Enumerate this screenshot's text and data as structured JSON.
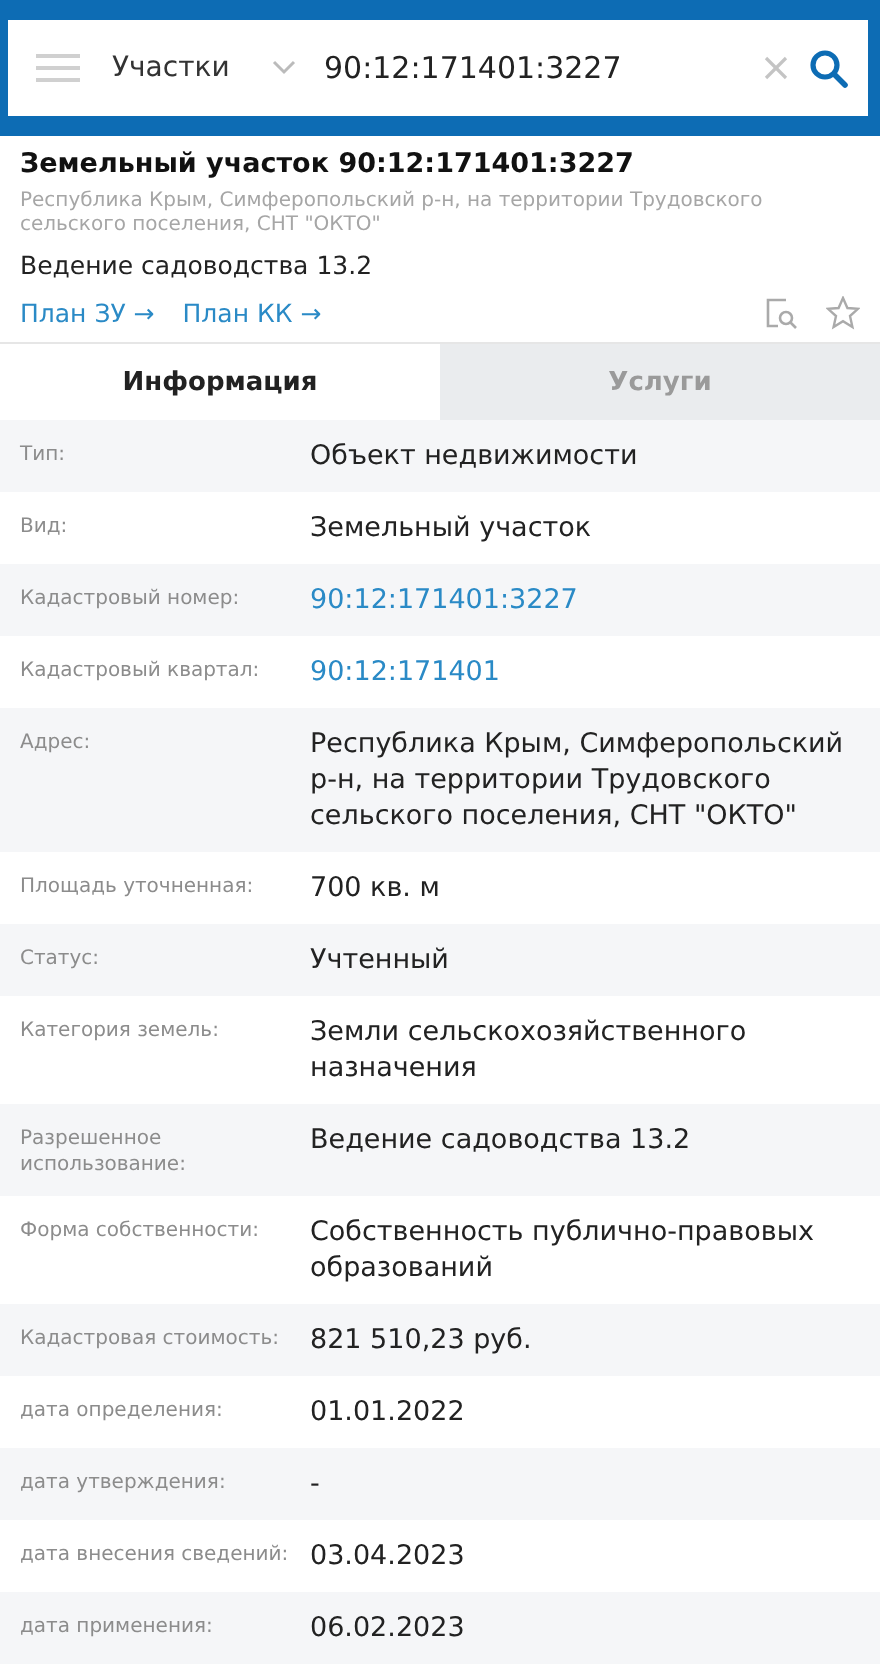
{
  "search": {
    "category": "Участки",
    "value": "90:12:171401:3227"
  },
  "object": {
    "title": "Земельный участок 90:12:171401:3227",
    "address": "Республика Крым, Симферопольский р-н, на территории Трудовского сельского поселения, СНТ \"ОКТО\"",
    "usage": "Ведение садоводства 13.2",
    "links": [
      "План ЗУ →",
      "План КК →"
    ],
    "favorite": false
  },
  "tabs": [
    {
      "label": "Информация",
      "selected": true
    },
    {
      "label": "Услуги",
      "selected": false
    }
  ],
  "rows": [
    {
      "label": "Тип:",
      "value": "Объект недвижимости",
      "kind": "text"
    },
    {
      "label": "Вид:",
      "value": "Земельный участок",
      "kind": "text"
    },
    {
      "label": "Кадастровый номер:",
      "value": "90:12:171401:3227",
      "kind": "link"
    },
    {
      "label": "Кадастровый квартал:",
      "value": "90:12:171401",
      "kind": "link"
    },
    {
      "label": "Адрес:",
      "value": "Республика Крым, Симферопольский р-н, на территории Трудовского сельского поселения, СНТ \"ОКТО\"",
      "kind": "text"
    },
    {
      "label": "Площадь уточненная:",
      "value": "700 кв. м",
      "kind": "text"
    },
    {
      "label": "Статус:",
      "value": "Учтенный",
      "kind": "text"
    },
    {
      "label": "Категория земель:",
      "value": "Земли сельскохозяйственного назначения",
      "kind": "text"
    },
    {
      "label": "Разрешенное использование:",
      "value": "Ведение садоводства 13.2",
      "kind": "text"
    },
    {
      "label": "Форма собственности:",
      "value": "Собственность публично-правовых образований",
      "kind": "text"
    },
    {
      "label": "Кадастровая стоимость:",
      "value": "821 510,23 руб.",
      "kind": "text"
    },
    {
      "label": "дата определения:",
      "value": "01.01.2022",
      "kind": "text"
    },
    {
      "label": "дата утверждения:",
      "value": "-",
      "kind": "text"
    },
    {
      "label": "дата внесения сведений:",
      "value": "03.04.2023",
      "kind": "text"
    },
    {
      "label": "дата применения:",
      "value": "06.02.2023",
      "kind": "text"
    }
  ]
}
